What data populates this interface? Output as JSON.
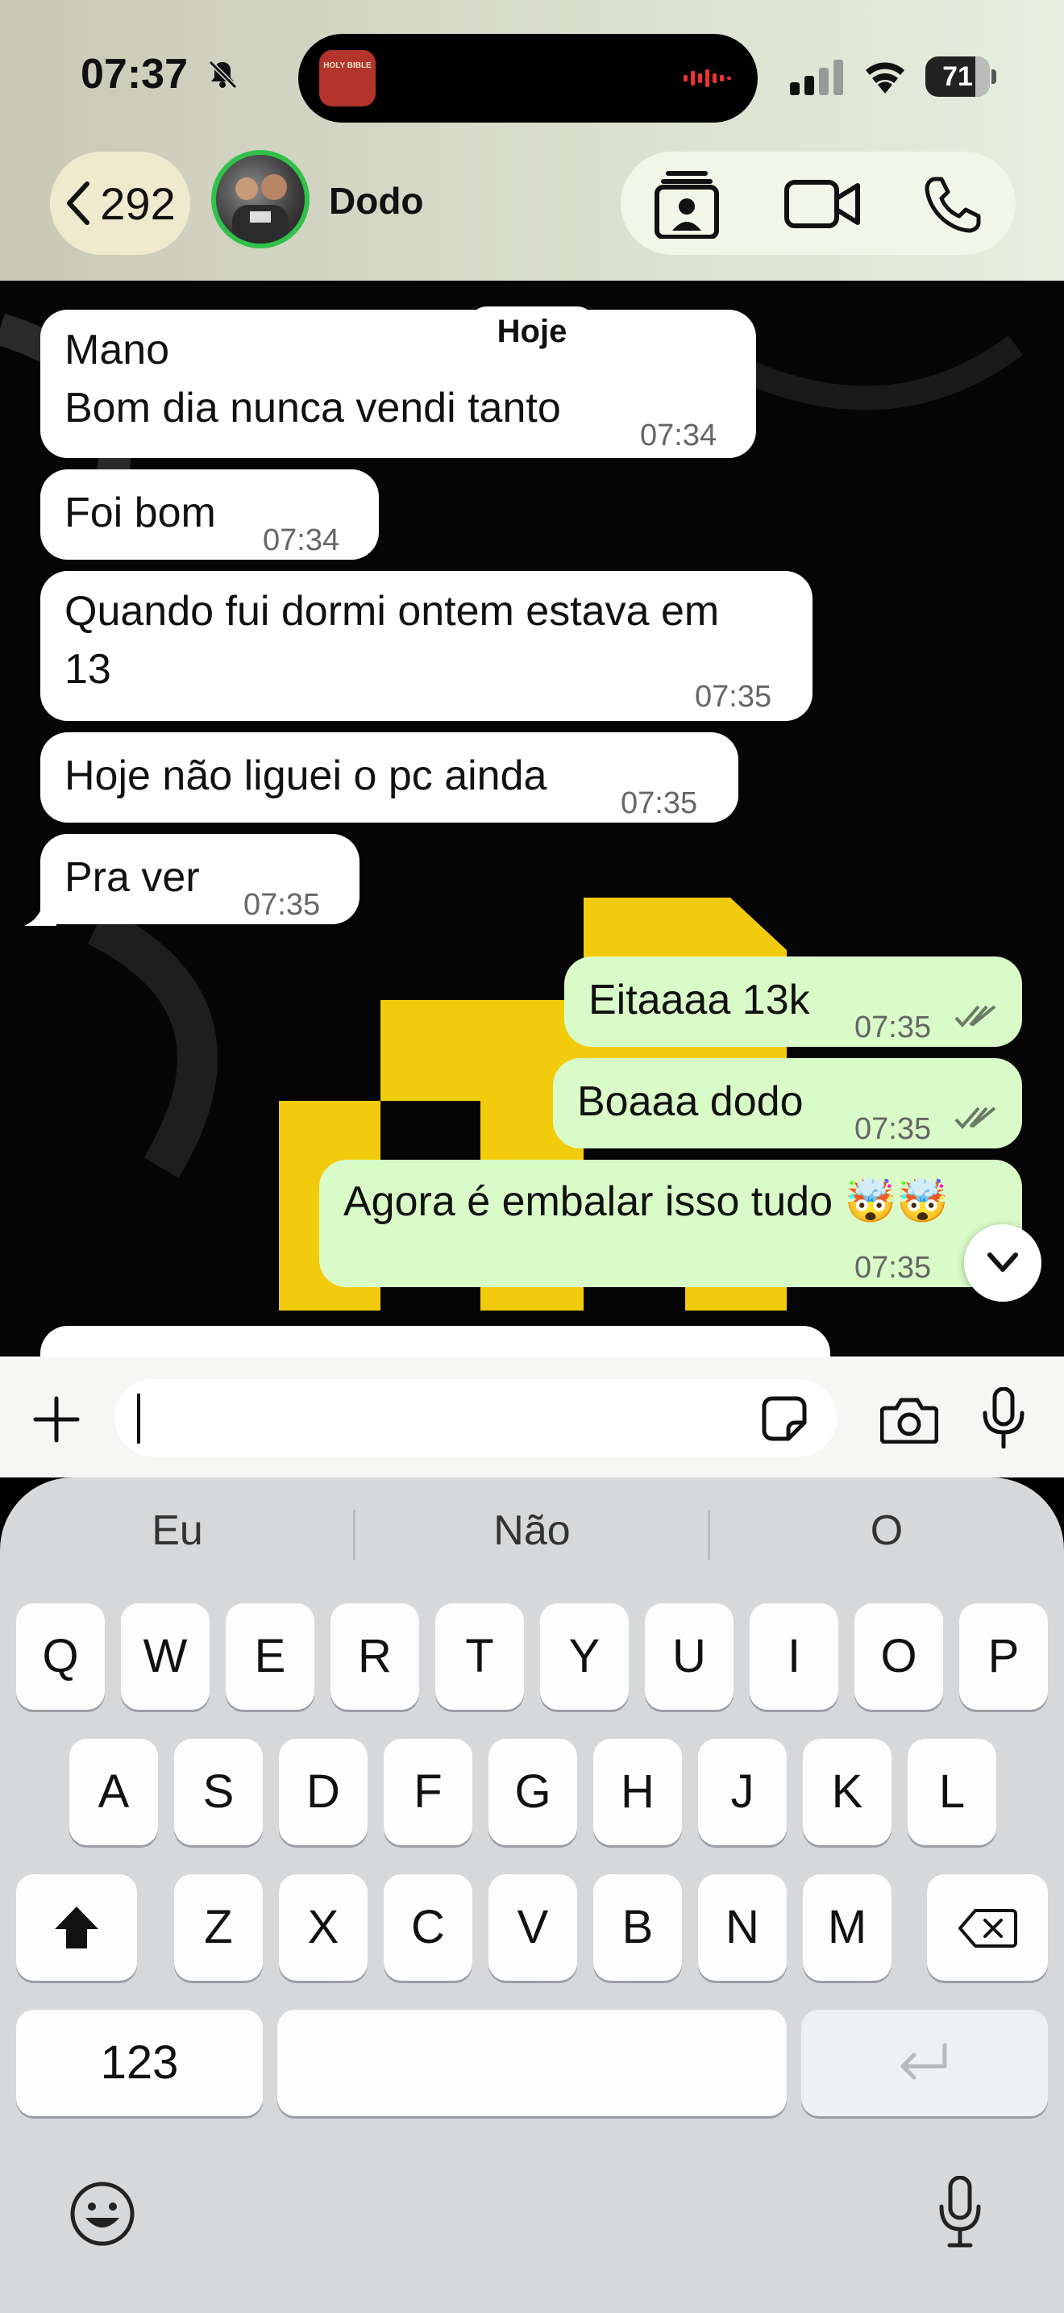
{
  "status_bar": {
    "time": "07:37",
    "app_badge": "HOLY BIBLE",
    "battery": "71",
    "icons": [
      "bell-slash-icon",
      "sound-wave-icon",
      "cellular-signal-icon",
      "wifi-icon",
      "battery-icon"
    ]
  },
  "header": {
    "back_count": "292",
    "contact_name": "Dodo",
    "actions": [
      "contact-card-icon",
      "video-call-icon",
      "phone-icon"
    ]
  },
  "chat": {
    "date_chip": "Hoje",
    "incoming": [
      {
        "lines": [
          "Mano",
          "Bom dia nunca vendi tanto"
        ],
        "time": "07:34"
      },
      {
        "lines": [
          "Foi bom"
        ],
        "time": "07:34"
      },
      {
        "lines": [
          "Quando fui dormi ontem estava em",
          "13"
        ],
        "time": "07:35"
      },
      {
        "lines": [
          "Hoje não liguei o pc ainda"
        ],
        "time": "07:35"
      },
      {
        "lines": [
          "Pra ver"
        ],
        "time": "07:35"
      }
    ],
    "outgoing": [
      {
        "text": "Eitaaaa 13k",
        "time": "07:35",
        "status": "read"
      },
      {
        "text": "Boaaa dodo",
        "time": "07:35",
        "status": "read"
      },
      {
        "text": "Agora é embalar isso tudo 🤯🤯",
        "time": "07:35",
        "status": "read"
      }
    ]
  },
  "composer": {
    "placeholder": "",
    "icons": [
      "plus-icon",
      "sticker-icon",
      "camera-icon",
      "microphone-icon"
    ]
  },
  "keyboard": {
    "suggestions": [
      "Eu",
      "Não",
      "O"
    ],
    "row1": [
      "Q",
      "W",
      "E",
      "R",
      "T",
      "Y",
      "U",
      "I",
      "O",
      "P"
    ],
    "row2": [
      "A",
      "S",
      "D",
      "F",
      "G",
      "H",
      "J",
      "K",
      "L"
    ],
    "row3": [
      "Z",
      "X",
      "C",
      "V",
      "B",
      "N",
      "M"
    ],
    "numbers_key": "123",
    "colors": {
      "accent_green": "#2fc14a",
      "outgoing_bubble": "#d9fbc8",
      "read_ticks": "#53bdeb"
    }
  }
}
